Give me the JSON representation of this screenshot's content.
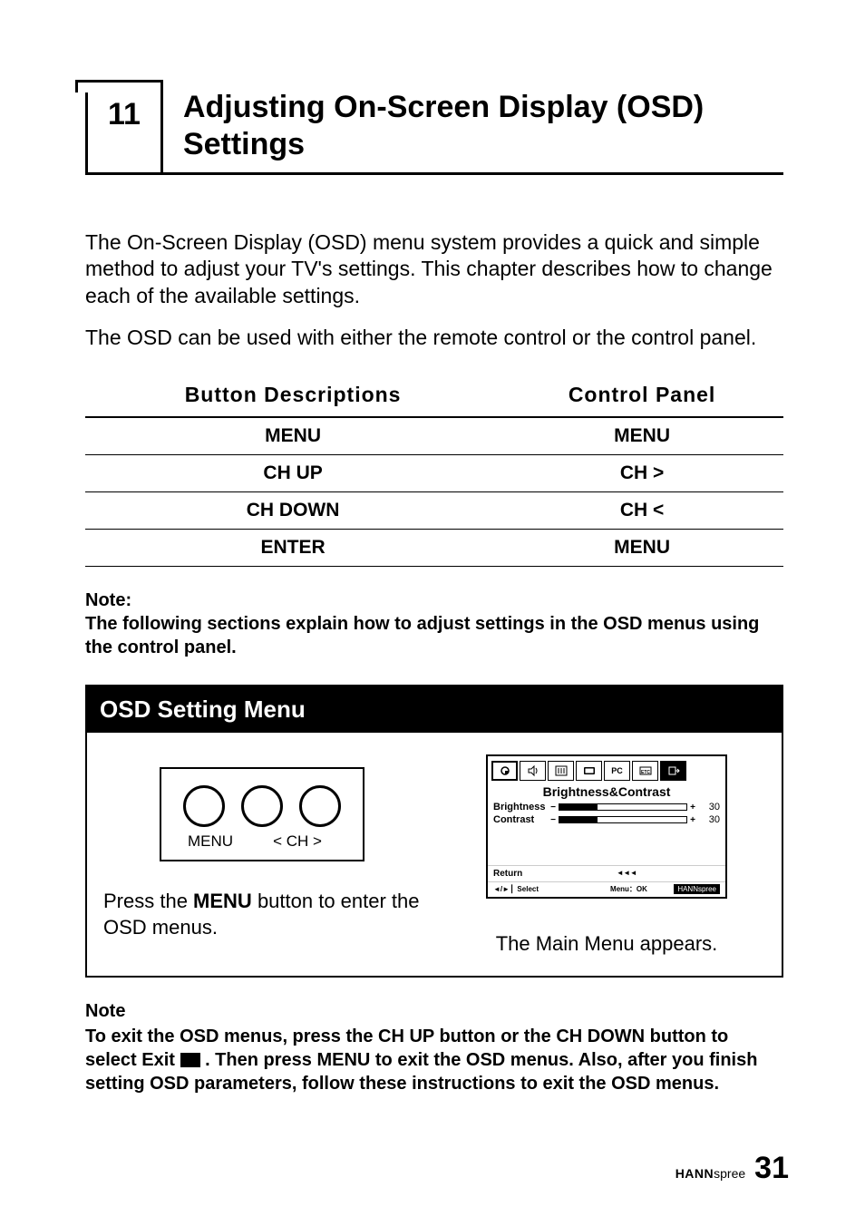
{
  "chapter": {
    "number": "11",
    "title": "Adjusting On-Screen Display (OSD) Settings"
  },
  "intro": {
    "p1": "The On-Screen Display (OSD) menu system provides a quick and simple method to adjust your TV's settings. This chapter describes how to change each of the available settings.",
    "p2": "The OSD can be used with either the remote control or the control  panel."
  },
  "table": {
    "h1": "Button Descriptions",
    "h2": "Control Panel",
    "rows": [
      {
        "c1": "MENU",
        "c2": "MENU"
      },
      {
        "c1": "CH UP",
        "c2": "CH >"
      },
      {
        "c1": "CH DOWN",
        "c2": "CH <"
      },
      {
        "c1": "ENTER",
        "c2": "MENU"
      }
    ]
  },
  "note1": {
    "label": "Note:",
    "text": "The following sections explain how to adjust settings in the OSD menus using the control panel."
  },
  "osd_panel": {
    "title": "OSD Setting Menu",
    "control_labels": {
      "menu": "MENU",
      "ch": "<  CH  >"
    },
    "left_caption_pre": "Press the ",
    "left_caption_bold": "MENU",
    "left_caption_post": " button to enter the OSD menus.",
    "right_caption": "The Main Menu appears.",
    "screenshot": {
      "icons": [
        "sun",
        "speaker",
        "tools",
        "screen",
        "PC",
        "ETC",
        "exit"
      ],
      "subtitle": "Brightness&Contrast",
      "rows": [
        {
          "label": "Brightness",
          "value": "30"
        },
        {
          "label": "Contrast",
          "value": "30"
        }
      ],
      "return_label": "Return",
      "return_sym": "◄◄◄",
      "select_label": "◄/►  ▏Select",
      "menu_ok": "Menu：OK",
      "brand": "HANNspree"
    }
  },
  "note2": {
    "label": "Note",
    "t1": "To exit the OSD menus, press the CH UP button or the CH DOWN button to select Exit ",
    "t2": " . Then press MENU to exit the OSD menus. Also, after you finish setting OSD parameters, follow these instructions to exit the OSD menus."
  },
  "footer": {
    "brand1": "HANN",
    "brand2": "spree",
    "page": "31"
  }
}
